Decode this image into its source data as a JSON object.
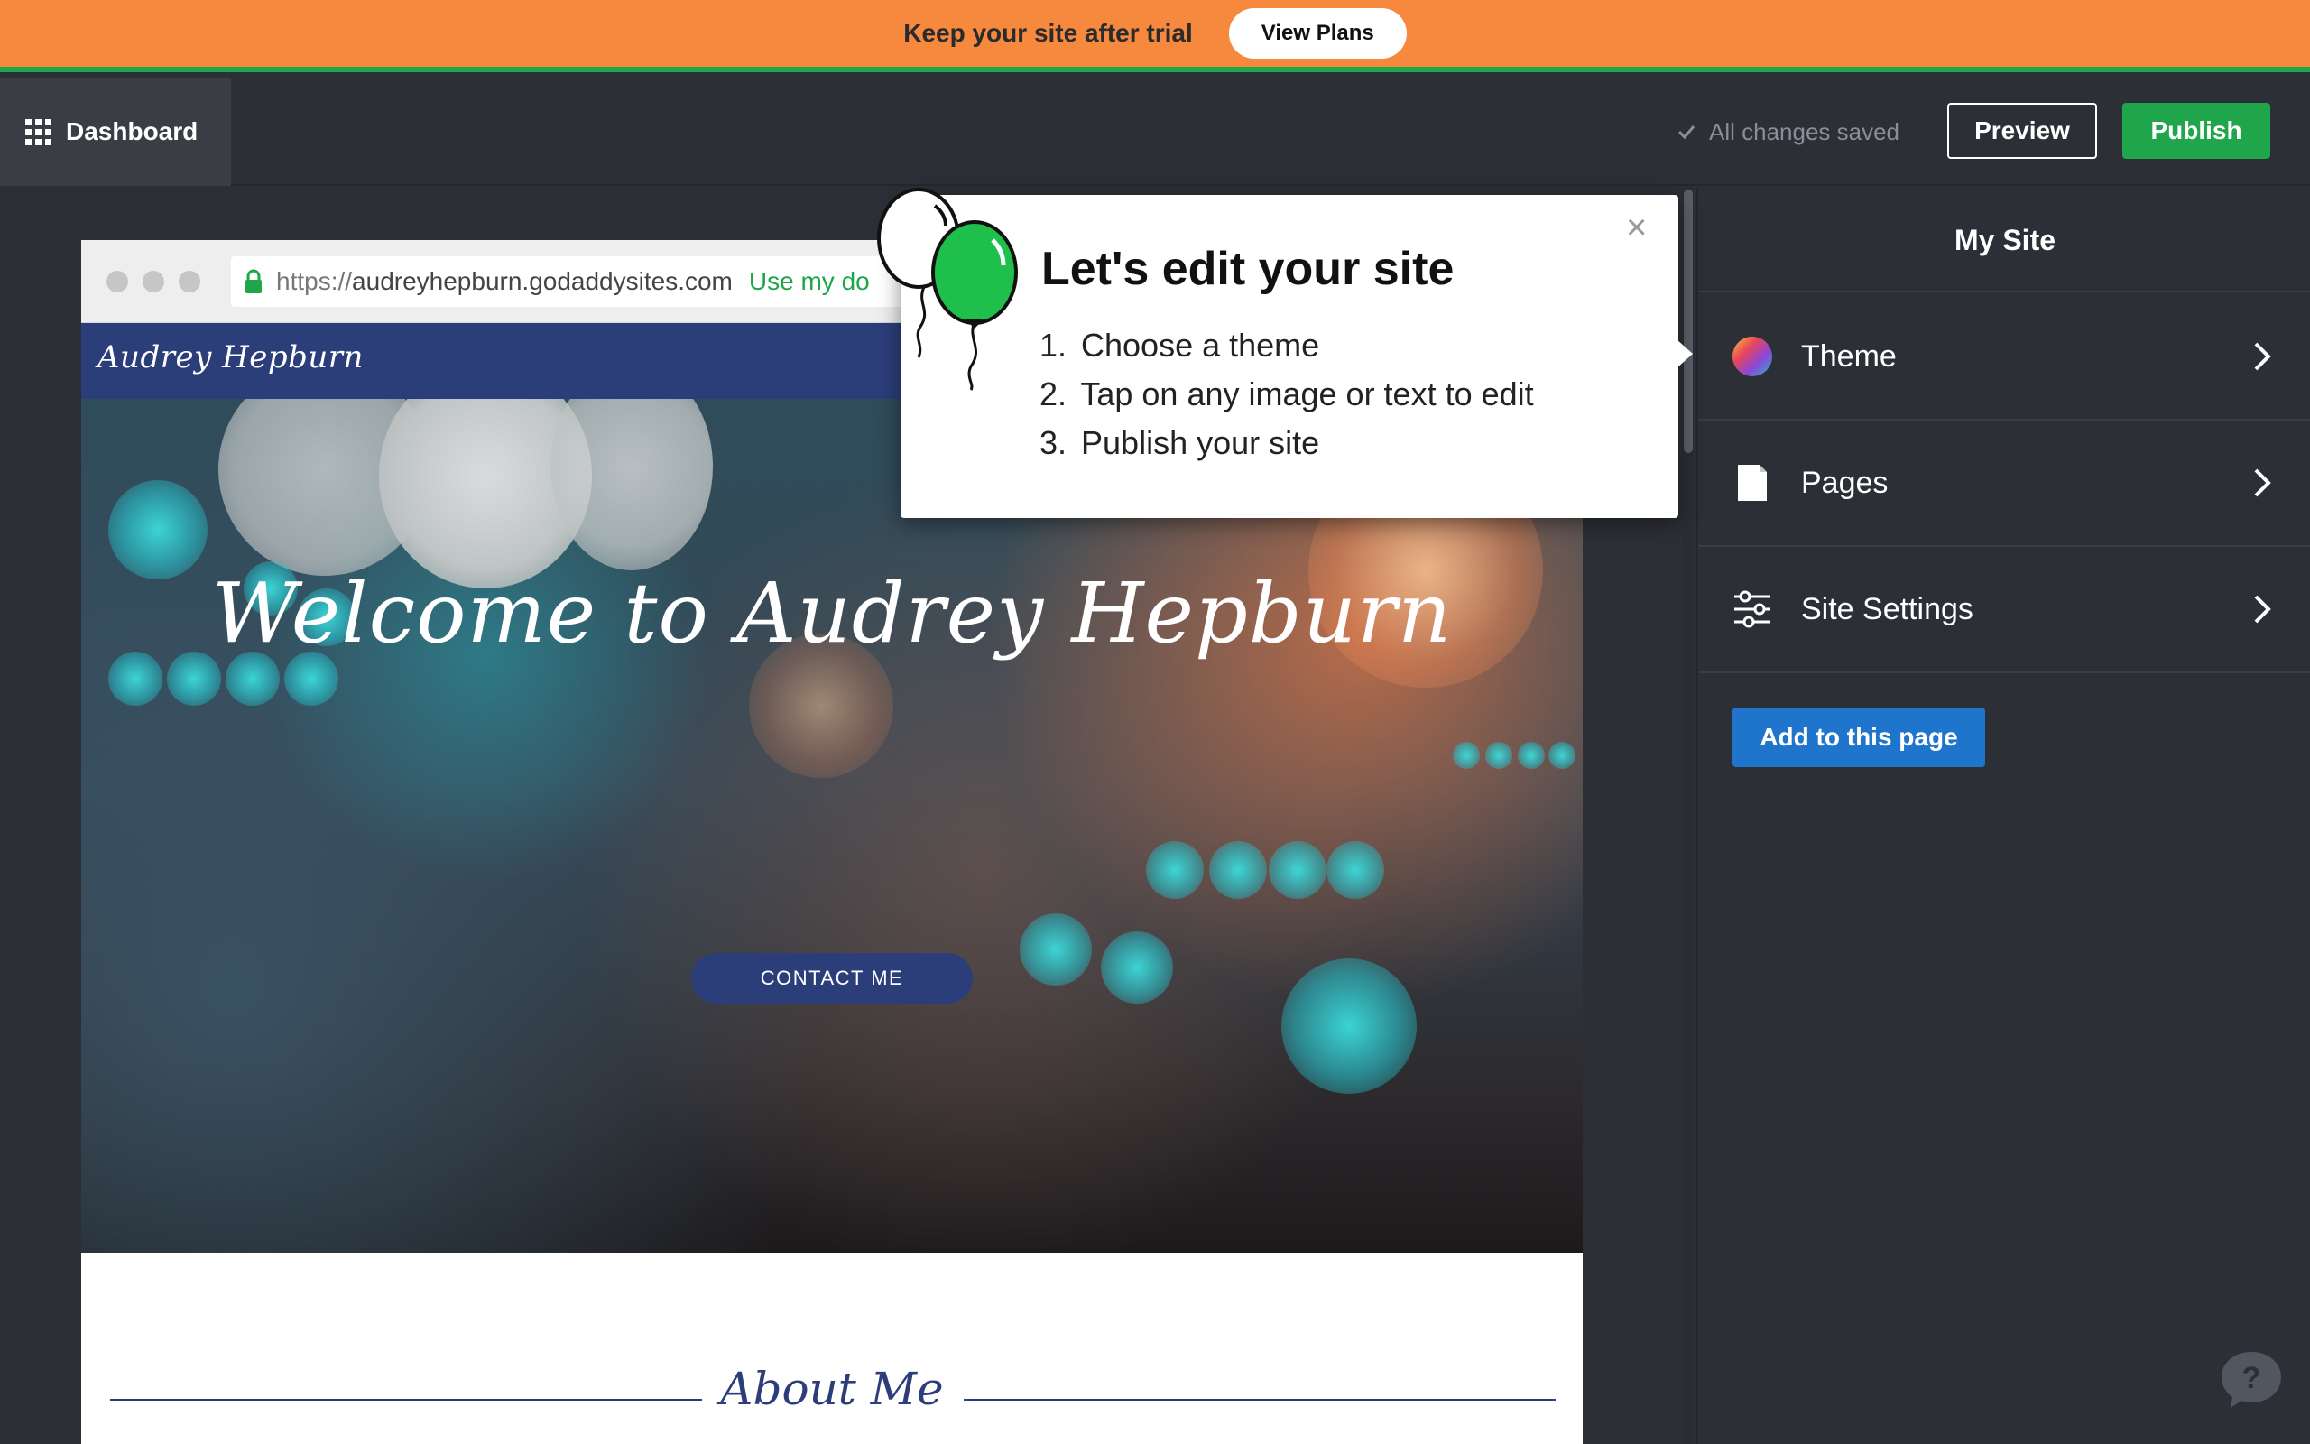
{
  "banner": {
    "text": "Keep your site after trial",
    "button": "View Plans"
  },
  "toolbar": {
    "dashboard": "Dashboard",
    "status": "All changes saved",
    "preview": "Preview",
    "publish": "Publish"
  },
  "preview": {
    "url_protocol": "https://",
    "url_host": "audreyhepburn.godaddysites.com",
    "use_domain": "Use my do",
    "site_logo": "Audrey Hepburn",
    "hero_title": "Welcome to Audrey Hepburn",
    "contact_button": "CONTACT ME",
    "about_title": "About Me"
  },
  "tooltip": {
    "title": "Let's edit your site",
    "close": "×",
    "steps": [
      {
        "num": "1.",
        "text": "Choose a theme"
      },
      {
        "num": "2.",
        "text": "Tap on any image or text to edit"
      },
      {
        "num": "3.",
        "text": "Publish your site"
      }
    ]
  },
  "panel": {
    "title": "My Site",
    "items": [
      {
        "label": "Theme",
        "icon": "color-wheel-icon"
      },
      {
        "label": "Pages",
        "icon": "page-icon"
      },
      {
        "label": "Site Settings",
        "icon": "sliders-icon"
      }
    ],
    "add_button": "Add to this page"
  },
  "colors": {
    "banner": "#f7893f",
    "banner_accent": "#1fa64a",
    "publish": "#1fa64a",
    "add_button": "#1f75cc",
    "site_nav": "#2c3e7a",
    "app_bg": "#2c2f36"
  },
  "help": {
    "icon": "help-icon"
  }
}
